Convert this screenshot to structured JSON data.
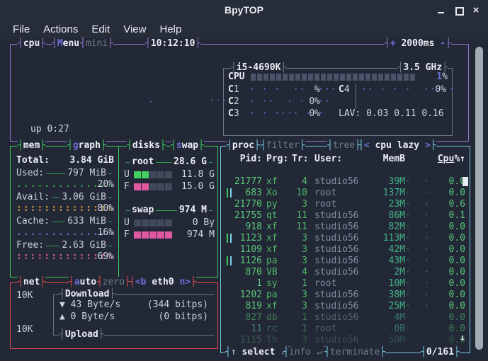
{
  "window": {
    "title": "BpyTOP"
  },
  "icons": {
    "minimize": "–",
    "maximize": "□",
    "close": "×",
    "scroll_down": "↓",
    "down_arrow": "▼",
    "up_arrow": "▲"
  },
  "menu": {
    "items": [
      "File",
      "Actions",
      "Edit",
      "View",
      "Help"
    ]
  },
  "colors": {
    "cpu_border": "#8f76cf",
    "mem_border": "#3ecb5d",
    "net_border": "#e04848",
    "proc_border": "#74c6de",
    "accent_blue": "#6b6fd8",
    "used_graph": "#2fa44e",
    "avail_graph": "#cf9a3d",
    "cache_graph": "#5b7fc8",
    "free_graph": "#d45da8",
    "meter_green": "#41d05f",
    "meter_pink": "#e058a0",
    "proc_green": "#56c77b"
  },
  "cpu": {
    "box_label": "cpu",
    "menu_label_hi": "M",
    "menu_label_rest": "enu",
    "mini_label": "mini",
    "clock": "10:12:10",
    "rate_plus": "+",
    "rate": "2000ms",
    "rate_minus": "-",
    "model": "i5-4690K",
    "frequency": "3.5 GHz",
    "total_label": "CPU",
    "total_percent_num": "1",
    "total_percent_sign": "%",
    "cores": [
      {
        "label": "C1",
        "graph": "· · ·  ·· ····",
        "percent": "%"
      },
      {
        "label": "C2",
        "graph": "· ··  · ·  ··",
        "percent": "0%"
      },
      {
        "label": "C3",
        "graph": "· · ···· ···",
        "percent": "0%"
      },
      {
        "label": "C4",
        "graph": "·· · · ·  ··· ·",
        "percent": "0%"
      }
    ],
    "load_avg": "LAV: 0.03 0.11 0.16",
    "uptime": "up 0:27"
  },
  "mem": {
    "box_label": "mem",
    "graph_label_hi": "g",
    "graph_label_rest": "raph",
    "total_label": "Total:",
    "total_value": "3.84 GiB",
    "rows": [
      {
        "label": "Used:",
        "value": "797 MiB",
        "percent": "20%",
        "dot_char": ".",
        "color": "#2fa44e"
      },
      {
        "label": "Avail:",
        "value": "3.06 GiB",
        "percent": "80%",
        "dot_char": ":",
        "color": "#cf9a3d"
      },
      {
        "label": "Cache:",
        "value": "633 MiB",
        "percent": "16%",
        "dot_char": ".",
        "color": "#5b7fc8"
      },
      {
        "label": "Free:",
        "value": "2.63 GiB",
        "percent": "69%",
        "dot_char": ":",
        "color": "#d45da8"
      }
    ]
  },
  "disks": {
    "box_label": "disks",
    "swap_label_hi": "s",
    "swap_label_rest": "wap",
    "drives": [
      {
        "name": "root",
        "total": "28.6 G",
        "u_label": "U",
        "u_value": "11.8 G",
        "u_fill": 2,
        "u_color": "#41d05f",
        "f_label": "F",
        "f_value": "15.0 G",
        "f_fill": 2,
        "f_color": "#e058a0",
        "segments": 5
      },
      {
        "name": "swap",
        "total": "974 M",
        "u_label": "U",
        "u_value": "0 By",
        "u_fill": 0,
        "u_color": "#41d05f",
        "f_label": "F",
        "f_value": "974 M",
        "f_fill": 5,
        "f_color": "#e058a0",
        "segments": 5
      }
    ]
  },
  "net": {
    "box_label": "net",
    "auto_label_hi": "a",
    "auto_label_rest": "uto",
    "zero_label": "zero",
    "iface_prev": "<b",
    "iface": "eth0",
    "iface_next": "n>",
    "scale_down": "10K",
    "scale_up": "10K",
    "download_label": "Download",
    "upload_label": "Upload",
    "down_speed": "43 Byte/s",
    "down_bits": "(344 bitps)",
    "up_speed": "0 Byte/s",
    "up_bits": "(0 bitps)"
  },
  "proc": {
    "box_label": "proc",
    "filter_label": "filter",
    "tree_label": "tree",
    "sort_prev": "<",
    "sort_label": " cpu lazy ",
    "sort_next": ">",
    "header": {
      "pid": "Pid:",
      "prg": "Prg:",
      "tr": "Tr:",
      "user": "User:",
      "mem": "MemB",
      "cpu": "Cpu",
      "cpu_suffix": "%↑"
    },
    "rows": [
      {
        "pid": "21777",
        "prg": "xf",
        "tr": "4",
        "user": "studio56",
        "mem": "39M",
        "cpu": "0.0",
        "tree": false,
        "dim": 0,
        "selected": true
      },
      {
        "pid": "683",
        "prg": "Xo",
        "tr": "10",
        "user": "root",
        "mem": "137M",
        "cpu": "0.0",
        "tree": true,
        "dim": 0,
        "selected": false
      },
      {
        "pid": "21770",
        "prg": "py",
        "tr": "3",
        "user": "root",
        "mem": "23M",
        "cpu": "0.6",
        "tree": false,
        "dim": 0,
        "selected": false
      },
      {
        "pid": "21755",
        "prg": "qt",
        "tr": "11",
        "user": "studio56",
        "mem": "86M",
        "cpu": "0.1",
        "tree": false,
        "dim": 0,
        "selected": false
      },
      {
        "pid": "918",
        "prg": "xf",
        "tr": "11",
        "user": "studio56",
        "mem": "82M",
        "cpu": "0.0",
        "tree": false,
        "dim": 0,
        "selected": false
      },
      {
        "pid": "1123",
        "prg": "xf",
        "tr": "3",
        "user": "studio56",
        "mem": "113M",
        "cpu": "0.0",
        "tree": true,
        "dim": 0,
        "selected": false
      },
      {
        "pid": "1109",
        "prg": "xf",
        "tr": "3",
        "user": "studio56",
        "mem": "42M",
        "cpu": "0.0",
        "tree": false,
        "dim": 0,
        "selected": false
      },
      {
        "pid": "1126",
        "prg": "pa",
        "tr": "3",
        "user": "studio56",
        "mem": "43M",
        "cpu": "0.0",
        "tree": true,
        "dim": 0,
        "selected": false
      },
      {
        "pid": "870",
        "prg": "VB",
        "tr": "4",
        "user": "studio56",
        "mem": "2M",
        "cpu": "0.0",
        "tree": false,
        "dim": 0,
        "selected": false
      },
      {
        "pid": "1",
        "prg": "sy",
        "tr": "1",
        "user": "root",
        "mem": "10M",
        "cpu": "0.0",
        "tree": false,
        "dim": 0,
        "selected": false
      },
      {
        "pid": "1202",
        "prg": "pa",
        "tr": "3",
        "user": "studio56",
        "mem": "38M",
        "cpu": "0.0",
        "tree": false,
        "dim": 0,
        "selected": false
      },
      {
        "pid": "819",
        "prg": "xf",
        "tr": "3",
        "user": "studio56",
        "mem": "25M",
        "cpu": "0.0",
        "tree": false,
        "dim": 0,
        "selected": false
      },
      {
        "pid": "827",
        "prg": "db",
        "tr": "1",
        "user": "studio56",
        "mem": "4M",
        "cpu": "0.0",
        "tree": false,
        "dim": 1,
        "selected": false
      },
      {
        "pid": "11",
        "prg": "rc",
        "tr": "1",
        "user": "root",
        "mem": "0B",
        "cpu": "0.0",
        "tree": false,
        "dim": 1,
        "selected": false
      },
      {
        "pid": "1115",
        "prg": "Th",
        "tr": "3",
        "user": "studio56",
        "mem": "50M",
        "cpu": "0.0",
        "tree": false,
        "dim": 2,
        "selected": false
      }
    ],
    "footer": {
      "up": "↑ ",
      "select": "select",
      "down": " ↓",
      "info": "info ↵",
      "terminate": "terminate",
      "count": "0/161"
    }
  }
}
